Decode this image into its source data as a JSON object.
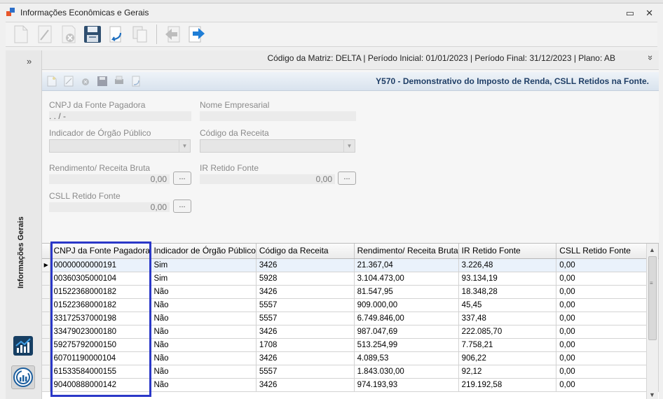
{
  "window": {
    "title": "Informações Econômicas e Gerais",
    "minimize_symbol": "▭",
    "close_symbol": "✕"
  },
  "toolbar": {
    "buttons": [
      "new-icon",
      "edit-icon",
      "delete-icon",
      "save-icon",
      "undo-icon",
      "copy-icon",
      "back-icon",
      "forward-icon"
    ]
  },
  "sidebar": {
    "collapse_symbol": "»",
    "section_label": "Informações Gerais"
  },
  "header": {
    "info": "Código da Matriz: DELTA | Período Inicial: 01/01/2023 | Período Final: 31/12/2023 | Plano: AB",
    "expand_symbol": "»"
  },
  "form": {
    "heading": "Y570 - Demonstrativo do Imposto de Renda, CSLL Retidos na Fonte.",
    "cnpj_label": "CNPJ da Fonte Pagadora",
    "cnpj_value": " .  .  /  -",
    "nome_label": "Nome Empresarial",
    "nome_value": "",
    "orgao_label": "Indicador de Órgão Público",
    "receita_label": "Código da Receita",
    "rendimento_label": "Rendimento/ Receita Bruta",
    "rendimento_value": "0,00",
    "ir_label": "IR Retido Fonte",
    "ir_value": "0,00",
    "csll_label": "CSLL Retido Fonte",
    "csll_value": "0,00",
    "ellipsis": "..."
  },
  "grid": {
    "columns": [
      "CNPJ da Fonte Pagadora",
      "Indicador de Órgão Público",
      "Código da Receita",
      "Rendimento/ Receita Bruta",
      "IR Retido Fonte",
      "CSLL Retido Fonte"
    ],
    "current_row_marker": "▶",
    "rows": [
      [
        "00000000000191",
        "Sim",
        "3426",
        "21.367,04",
        "3.226,48",
        "0,00"
      ],
      [
        "00360305000104",
        "Sim",
        "5928",
        "3.104.473,00",
        "93.134,19",
        "0,00"
      ],
      [
        "01522368000182",
        "Não",
        "3426",
        "81.547,95",
        "18.348,28",
        "0,00"
      ],
      [
        "01522368000182",
        "Não",
        "5557",
        "909.000,00",
        "45,45",
        "0,00"
      ],
      [
        "33172537000198",
        "Não",
        "5557",
        "6.749.846,00",
        "337,48",
        "0,00"
      ],
      [
        "33479023000180",
        "Não",
        "3426",
        "987.047,69",
        "222.085,70",
        "0,00"
      ],
      [
        "59275792000150",
        "Não",
        "1708",
        "513.254,99",
        "7.758,21",
        "0,00"
      ],
      [
        "60701190000104",
        "Não",
        "3426",
        "4.089,53",
        "906,22",
        "0,00"
      ],
      [
        "61533584000155",
        "Não",
        "5557",
        "1.843.030,00",
        "92,12",
        "0,00"
      ],
      [
        "90400888000142",
        "Não",
        "3426",
        "974.193,93",
        "219.192,58",
        "0,00"
      ]
    ]
  },
  "colors": {
    "highlight": "#2b38c8",
    "heading": "#1f3e66"
  }
}
